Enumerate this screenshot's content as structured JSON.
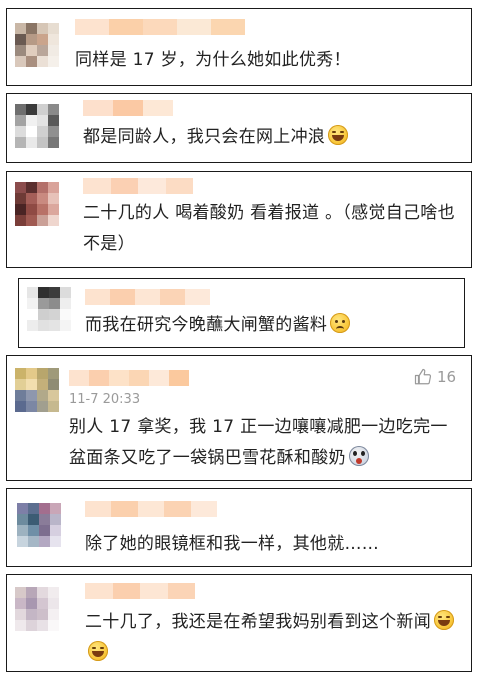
{
  "comments": [
    {
      "text": "同样是 17 岁，为什么她如此优秀！",
      "avatar": [
        "#c9b7a6",
        "#8a7565",
        "#d6c6b6",
        "#e7ddd1",
        "#6a5a52",
        "#b69a86",
        "#caa48c",
        "#efe6dc",
        "#9b8a7e",
        "#e0cdbe",
        "#b9a69a",
        "#f1ebe4",
        "#d9c8bb",
        "#a98f7f",
        "#ebe0d6",
        "#f5f0ea"
      ],
      "name_colors": [
        "#fde3cf",
        "#fbd0a9",
        "#fcd9bb",
        "#fbe9d6",
        "#fbd6b0"
      ]
    },
    {
      "text": "都是同龄人，我只会在网上冲浪",
      "emojis": [
        "laugh"
      ],
      "avatar": [
        "#6e6e6e",
        "#3b3b3b",
        "#cfcfcf",
        "#8a8a8a",
        "#a3a3a3",
        "#f1f1f1",
        "#e3e3e3",
        "#5a5a5a",
        "#dcdcdc",
        "#ffffff",
        "#d0d0d0",
        "#909090",
        "#b5b5b5",
        "#e9e9e9",
        "#c4c4c4",
        "#777777"
      ],
      "name_colors": [
        "#fde0cc",
        "#fbc9a4",
        "#fde8d6"
      ]
    },
    {
      "text": "二十几的人 喝着酸奶   看着报道   。（感觉自己啥也不是）",
      "avatar": [
        "#8b4c4c",
        "#5a2e2e",
        "#b3706a",
        "#d9a39a",
        "#6e3a36",
        "#a45e58",
        "#c98a80",
        "#e7c2b9",
        "#4a2424",
        "#8f4a44",
        "#b87268",
        "#dba79d",
        "#7a3e39",
        "#a05a52",
        "#caa097",
        "#efd6ce"
      ],
      "name_colors": [
        "#fde3d0",
        "#fbd0b3",
        "#fde9db",
        "#fcdcc4"
      ]
    },
    {
      "text": "而我在研究今晚蘸大闸蟹的酱料",
      "emojis": [
        "sad"
      ],
      "avatar": [
        "#e6e6e6",
        "#2f2f2f",
        "#3c3c3c",
        "#dcdcdc",
        "#f2f2f2",
        "#9a9a9a",
        "#8c8c8c",
        "#eeeeee",
        "#ffffff",
        "#cfcfcf",
        "#d3d3d3",
        "#fafafa",
        "#ededed",
        "#e1e1e1",
        "#e4e4e4",
        "#f4f4f4"
      ],
      "name_colors": [
        "#fde3cf",
        "#fbcfae",
        "#fde6d4",
        "#fbd4b6",
        "#fde9da"
      ]
    },
    {
      "text": "别人 17 拿奖，我 17 正一边嚷嚷减肥一边吃完一盆面条又吃了一袋锅巴雪花酥和酸奶",
      "emojis": [
        "shock"
      ],
      "time": "11-7 20:33",
      "likes": "16",
      "avatar": [
        "#cbb36a",
        "#e3c989",
        "#b8a66c",
        "#9f9a7a",
        "#e2cf96",
        "#f2deae",
        "#c4b07a",
        "#8f8c74",
        "#6f7d9a",
        "#8e97ae",
        "#b1a98a",
        "#d8c79c",
        "#5b6a8f",
        "#7c87a4",
        "#a19f8f",
        "#c6b98f"
      ],
      "name_colors": [
        "#fde3cf",
        "#fbcfae",
        "#fde2c8",
        "#fbd6b4",
        "#fde9d9",
        "#fbc99e"
      ]
    },
    {
      "text": "除了她的眼镜框和我一样，其他就……",
      "avatar": [
        "#7d7fa7",
        "#5c6e8f",
        "#a36e8e",
        "#c9a6b7",
        "#6d8b9e",
        "#3c5c74",
        "#8a7c99",
        "#b9b5c9",
        "#9db2c0",
        "#6f8fa7",
        "#7d6e8f",
        "#d6cfe0",
        "#c7d4de",
        "#a5b7c6",
        "#b3a8c2",
        "#e6e3ee"
      ],
      "name_colors": [
        "#fde3cf",
        "#fbd0ad",
        "#fde7d5",
        "#fbd3b3",
        "#fde9da"
      ]
    },
    {
      "text": "二十几了，我还是在希望我妈别看到这个新闻",
      "emojis": [
        "laugh",
        "laugh"
      ],
      "avatar": [
        "#d7c9c9",
        "#b8a7b8",
        "#e3d9de",
        "#f1ecee",
        "#c9b7c6",
        "#a897b0",
        "#d4c6d1",
        "#ece6ea",
        "#e2d8dd",
        "#c4b6c5",
        "#cdbfca",
        "#f4f0f2",
        "#efe9ec",
        "#ddd3da",
        "#e8e1e6",
        "#faf8f9"
      ],
      "name_colors": [
        "#fde3cf",
        "#fbcfae",
        "#fde6d4",
        "#fbd4b6"
      ]
    }
  ]
}
